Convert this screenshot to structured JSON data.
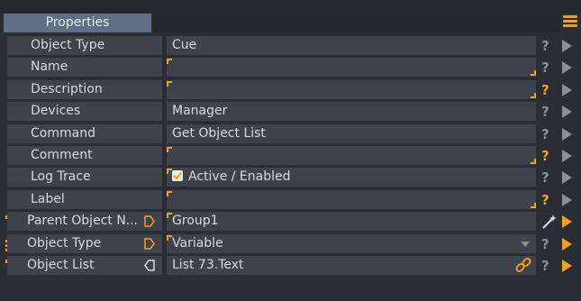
{
  "panel": {
    "tab_label": "Properties",
    "colors": {
      "accent": "#f2a024",
      "row_bg": "#3d424b",
      "panel_bg": "#2a2d33",
      "tab_bg": "#5f6f84",
      "muted": "#8a8f96"
    }
  },
  "rows": [
    {
      "label": "Object Type",
      "value": "Cue",
      "lead_icon": null
    },
    {
      "label": "Name",
      "value": "",
      "lead_icon": null
    },
    {
      "label": "Description",
      "value": "",
      "lead_icon": null
    },
    {
      "label": "Devices",
      "value": "Manager",
      "lead_icon": null
    },
    {
      "label": "Command",
      "value": "Get Object List",
      "lead_icon": null
    },
    {
      "label": "Comment",
      "value": "",
      "lead_icon": null
    },
    {
      "label": "Log Trace",
      "value": "Active / Enabled",
      "checked": true,
      "lead_icon": null
    },
    {
      "label": "Label",
      "value": "",
      "lead_icon": null
    },
    {
      "label": "Parent Object N...",
      "value": "Group1",
      "lead_icon": "text-type-icon",
      "port": "output-port-icon"
    },
    {
      "label": "Object Type",
      "value": "Variable",
      "lead_icon": "list-type-icon",
      "port": "output-port-icon"
    },
    {
      "label": "Object List",
      "value": "List  73.Text",
      "lead_icon": "text-type-icon",
      "port": "input-port-icon"
    }
  ],
  "icons": {
    "menu": "hamburger-menu-icon",
    "help": "question-mark-icon",
    "execute": "play-icon",
    "wand": "magic-wand-icon",
    "link": "link-icon",
    "dropdown": "chevron-down-icon",
    "checkbox": "checkbox-checked-icon"
  }
}
